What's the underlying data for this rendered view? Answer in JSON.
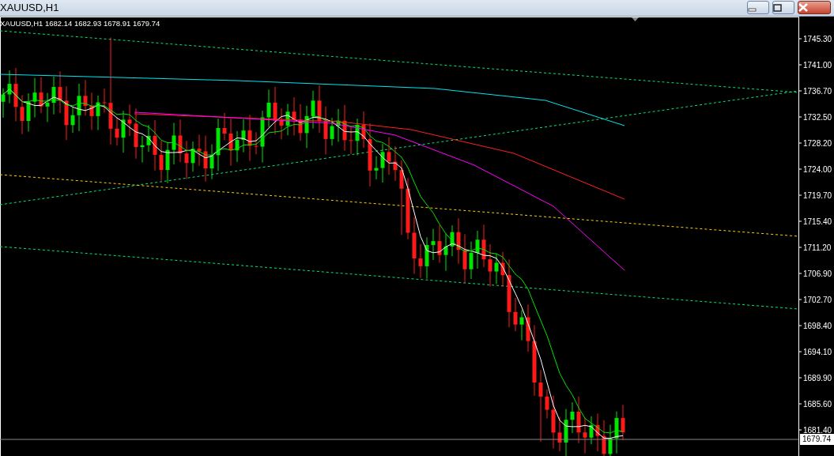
{
  "window": {
    "title": "XAUUSD,H1"
  },
  "legend": {
    "symbol": "XAUUSD,H1",
    "values": [
      "1682.14",
      "1682.93",
      "1678.91",
      "1679.74"
    ]
  },
  "price_axis": {
    "labels": [
      "1745.30",
      "1741.00",
      "1736.70",
      "1732.50",
      "1728.20",
      "1724.00",
      "1719.70",
      "1715.40",
      "1711.20",
      "1706.90",
      "1702.70",
      "1698.40",
      "1694.10",
      "1689.90",
      "1685.60",
      "1681.40"
    ],
    "current_price": "1679.74"
  }
}
